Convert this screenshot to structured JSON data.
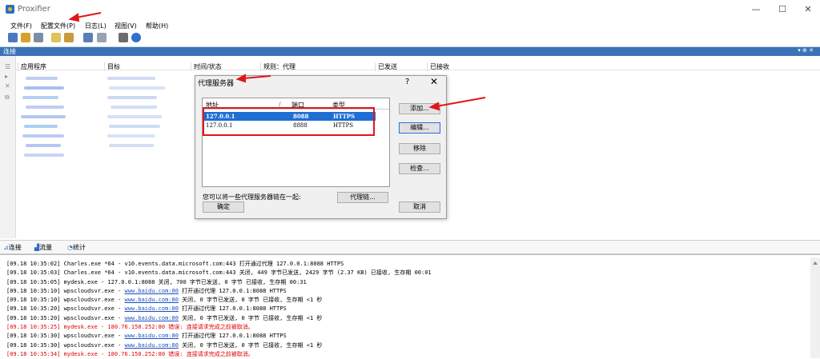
{
  "window": {
    "title": "Proxifier",
    "controls": {
      "minimize": "—",
      "maximize": "☐",
      "close": "✕"
    }
  },
  "menu": [
    "文件(F)",
    "配置文件(P)",
    "日志(L)",
    "视图(V)",
    "帮助(H)"
  ],
  "toolbar_icons": [
    "open-profile-icon",
    "save-profile-icon",
    "proxy-servers-icon",
    "proxification-rules-icon",
    "name-resolution-icon",
    "advanced-icon",
    "print-icon",
    "help-icon"
  ],
  "connections": {
    "title": "连接",
    "panel_controls": "▾ ⊕ ✕",
    "columns": [
      "应用程序",
      "目标",
      "时间/状态",
      "规则：代理",
      "已发送",
      "已接收"
    ]
  },
  "colors": {
    "accent": "#3a72b8",
    "selection": "#1f6ed4",
    "annotation": "#e0161b",
    "error_text": "#e00000",
    "link": "#1a4fbf"
  },
  "tabs": [
    {
      "label": "连接",
      "icon": "connections-icon"
    },
    {
      "label": "流量",
      "icon": "traffic-icon"
    },
    {
      "label": "统计",
      "icon": "statistics-icon"
    }
  ],
  "dialog": {
    "title": "代理服务器",
    "help": "?",
    "close": "✕",
    "list_headers": {
      "address": "地址",
      "sort_mark": "/",
      "port": "端口",
      "type": "类型"
    },
    "rows": [
      {
        "address": "127.0.0.1",
        "port": "8088",
        "type": "HTTPS",
        "selected": true
      },
      {
        "address": "127.0.0.1",
        "port": "8888",
        "type": "HTTPS",
        "selected": false
      }
    ],
    "buttons": {
      "add": "添加...",
      "edit": "编辑...",
      "remove": "移除",
      "check": "检查..."
    },
    "chain_text": "您可以将一些代理服务器链在一起:",
    "chain_button": "代理链...",
    "ok": "确定",
    "cancel": "取消"
  },
  "log": [
    {
      "pre": "[09.18 10:35:02] Charles.exe *64 - v10.events.data.microsoft.com:443 打开通过代理 127.0.0.1:8088 HTTPS",
      "link": "",
      "post": "",
      "error": false
    },
    {
      "pre": "[09.18 10:35:03] Charles.exe *64 - v10.events.data.microsoft.com:443 关闭, 449 字节已发送, 2429 字节 (2.37 KB) 已接收, 生存期 00:01",
      "link": "",
      "post": "",
      "error": false
    },
    {
      "pre": "[09.18 10:35:05] mydesk.exe - 127.0.0.1:8088 关闭, 700 字节已发送, 0 字节 已接收, 生存期 00:31",
      "link": "",
      "post": "",
      "error": false
    },
    {
      "pre": "[09.18 10:35:10] wpscloudsvr.exe - ",
      "link": "www.baidu.com:80",
      "post": " 打开通过代理 127.0.0.1:8088 HTTPS",
      "error": false
    },
    {
      "pre": "[09.18 10:35:10] wpscloudsvr.exe - ",
      "link": "www.baidu.com:80",
      "post": " 关闭, 0 字节已发送, 0 字节 已接收, 生存期 <1 秒",
      "error": false
    },
    {
      "pre": "[09.18 10:35:20] wpscloudsvr.exe - ",
      "link": "www.baidu.com:80",
      "post": " 打开通过代理 127.0.0.1:8088 HTTPS",
      "error": false
    },
    {
      "pre": "[09.18 10:35:20] wpscloudsvr.exe - ",
      "link": "www.baidu.com:80",
      "post": " 关闭, 0 字节已发送, 0 字节 已接收, 生存期 <1 秒",
      "error": false
    },
    {
      "pre": "[09.18 10:35:25] mydesk.exe - 180.76.150.252:80 错误: 连接请求完成之前被取消。",
      "link": "",
      "post": "",
      "error": true
    },
    {
      "pre": "[09.18 10:35:30] wpscloudsvr.exe - ",
      "link": "www.baidu.com:80",
      "post": " 打开通过代理 127.0.0.1:8088 HTTPS",
      "error": false
    },
    {
      "pre": "[09.18 10:35:30] wpscloudsvr.exe - ",
      "link": "www.baidu.com:80",
      "post": " 关闭, 0 字节已发送, 0 字节 已接收, 生存期 <1 秒",
      "error": false
    },
    {
      "pre": "[09.18 10:35:34] mydesk.exe - 180.76.150.252:80 错误: 连接请求完成之前被取消。",
      "link": "",
      "post": "",
      "error": true
    }
  ]
}
